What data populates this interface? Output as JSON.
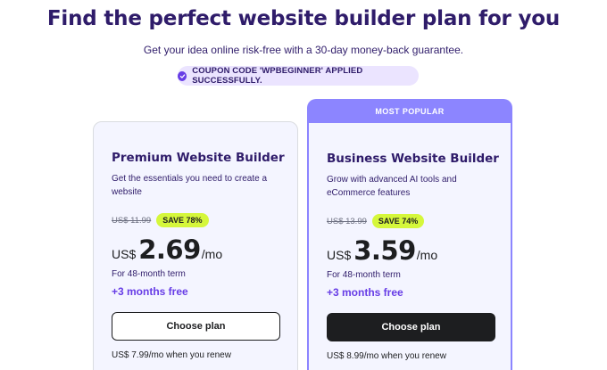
{
  "header": {
    "title": "Find the perfect website builder plan for you",
    "subtitle": "Get your idea online risk-free with a 30-day money-back guarantee.",
    "coupon_text": "COUPON CODE 'WPBEGINNER' APPLIED SUCCESSFULLY.",
    "coupon_icon": "check-circle-icon"
  },
  "colors": {
    "accent": "#673de6",
    "popular_banner": "#8c85ff",
    "save_badge": "#d5f73b",
    "heading": "#2f1c6a",
    "dark_button": "#1d1e20"
  },
  "plans": [
    {
      "name": "Premium Website Builder",
      "description": "Get the essentials you need to create a website",
      "old_price": "US$ 11.99",
      "save_label": "SAVE 78%",
      "currency": "US$",
      "price": "2.69",
      "period": "/mo",
      "term": "For 48-month term",
      "bonus": "+3 months free",
      "cta": "Choose plan",
      "renew": "US$ 7.99/mo when you renew"
    },
    {
      "badge": "MOST POPULAR",
      "name": "Business Website Builder",
      "description": "Grow with advanced AI tools and eCommerce features",
      "old_price": "US$ 13.99",
      "save_label": "SAVE 74%",
      "currency": "US$",
      "price": "3.59",
      "period": "/mo",
      "term": "For 48-month term",
      "bonus": "+3 months free",
      "cta": "Choose plan",
      "renew": "US$ 8.99/mo when you renew"
    }
  ]
}
